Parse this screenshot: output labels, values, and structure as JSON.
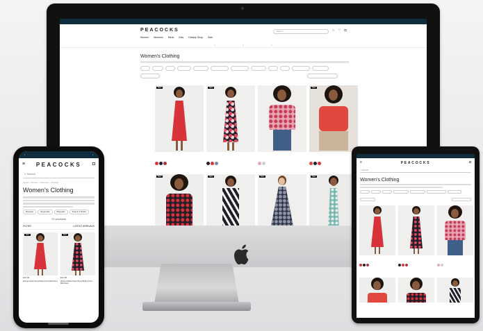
{
  "brand": "PEACOCKS",
  "page_title": "Women's Clothing",
  "desktop": {
    "nav": [
      "Women",
      "Womens",
      "Mens",
      "Kids",
      "Holiday Shop",
      "Sale"
    ],
    "search_placeholder": "Search",
    "tag": "New"
  },
  "phone": {
    "search_placeholder": "Search",
    "crumbs": "Home > Women > Womens > Clothing",
    "pills": [
      "Dresses",
      "Jumpsuits",
      "Playsuits",
      "Tops & T-Shirts"
    ],
    "count": "70 products",
    "filter_label": "FILTER",
    "sort_label": "LATEST ARRIVALS",
    "tag": "New",
    "products": [
      {
        "name": "Womens Red Tiered Button Front Midi Dress"
      },
      {
        "name": "Womens Black Floral Tiered Button Front Midi Dress"
      }
    ],
    "prices": [
      "£22.00",
      "£22.00"
    ]
  },
  "tablet": {
    "search_placeholder": "Search"
  },
  "colors": {
    "banner": "#0f2d3d",
    "red_dress": "#d8333a",
    "floral_dark": "#231f2a",
    "pink_top": "#e8a6b5",
    "coral_top": "#e0473f",
    "teal_dress": "#79b7ad"
  }
}
